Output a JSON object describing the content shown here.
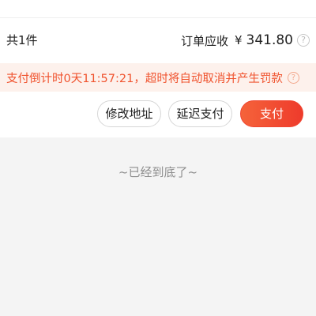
{
  "order": {
    "count_label": "共1件",
    "total_label": "订单应收",
    "currency": "¥",
    "amount": "341.80",
    "help_glyph": "?"
  },
  "banner": {
    "text": "支付倒计时0天11:57:21，超时将自动取消并产生罚款",
    "help_glyph": "?",
    "color": "#f0532e"
  },
  "actions": {
    "modify_address": "修改地址",
    "delay_payment": "延迟支付",
    "pay": "支付"
  },
  "footer": {
    "end_text": "~已经到底了~"
  },
  "colors": {
    "accent": "#ee3b2c",
    "background": "#f4f4f4"
  }
}
